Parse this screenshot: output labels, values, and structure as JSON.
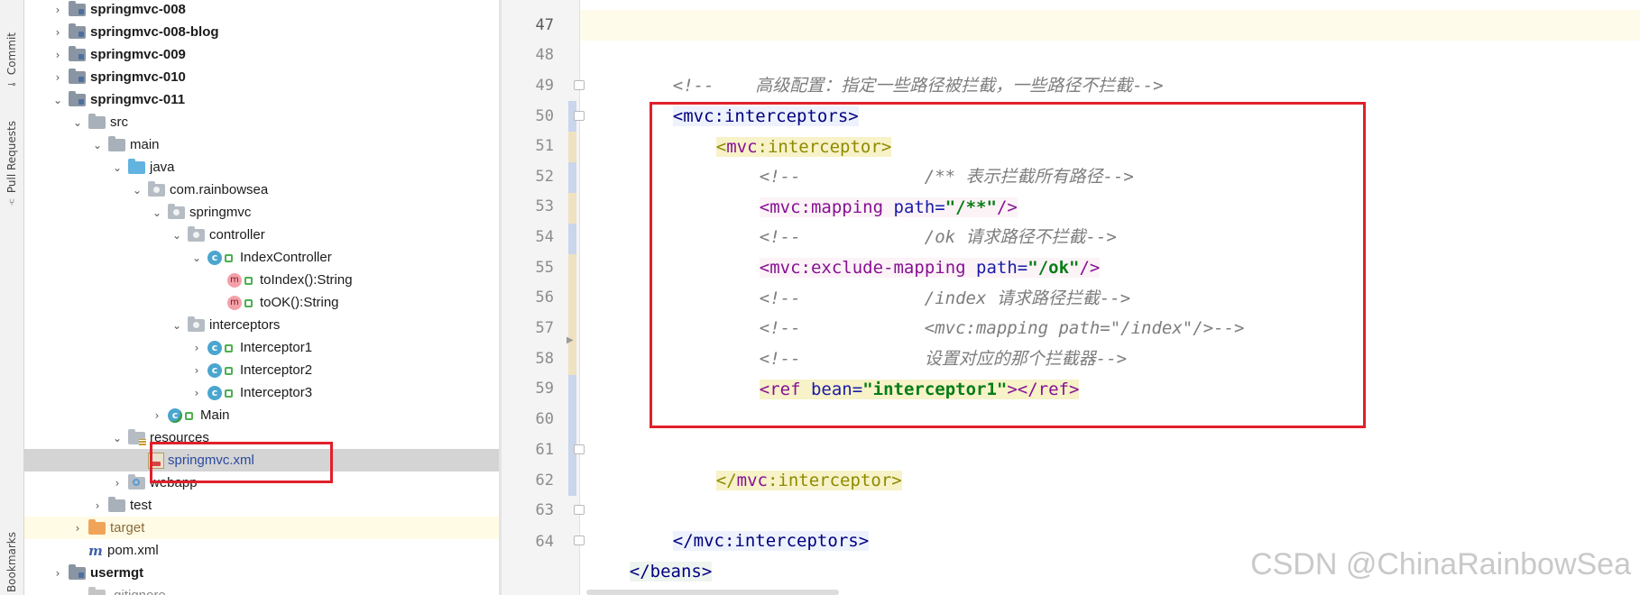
{
  "toolstrip": {
    "commit": "Commit",
    "pull_requests": "Pull Requests",
    "bookmarks": "Bookmarks"
  },
  "tree": {
    "rows": [
      {
        "label": "springmvc-008",
        "kind": "module",
        "arrow": "right"
      },
      {
        "label": "springmvc-008-blog",
        "kind": "module",
        "arrow": "right"
      },
      {
        "label": "springmvc-009",
        "kind": "module",
        "arrow": "right"
      },
      {
        "label": "springmvc-010",
        "kind": "module",
        "arrow": "right"
      },
      {
        "label": "springmvc-011",
        "kind": "module",
        "arrow": "down"
      },
      {
        "label": "src",
        "kind": "folder",
        "arrow": "down"
      },
      {
        "label": "main",
        "kind": "folder",
        "arrow": "down"
      },
      {
        "label": "java",
        "kind": "source-folder",
        "arrow": "down"
      },
      {
        "label": "com.rainbowsea",
        "kind": "package",
        "arrow": "down"
      },
      {
        "label": "springmvc",
        "kind": "package",
        "arrow": "down"
      },
      {
        "label": "controller",
        "kind": "package",
        "arrow": "down"
      },
      {
        "label": "IndexController",
        "kind": "class",
        "arrow": "down"
      },
      {
        "label": "toIndex():String",
        "kind": "method",
        "arrow": "none"
      },
      {
        "label": "toOK():String",
        "kind": "method",
        "arrow": "none"
      },
      {
        "label": "interceptors",
        "kind": "package",
        "arrow": "down"
      },
      {
        "label": "Interceptor1",
        "kind": "class",
        "arrow": "right"
      },
      {
        "label": "Interceptor2",
        "kind": "class",
        "arrow": "right"
      },
      {
        "label": "Interceptor3",
        "kind": "class",
        "arrow": "right"
      },
      {
        "label": "Main",
        "kind": "main-class",
        "arrow": "right"
      },
      {
        "label": "resources",
        "kind": "resources",
        "arrow": "down"
      },
      {
        "label": "springmvc.xml",
        "kind": "xml",
        "arrow": "none"
      },
      {
        "label": "webapp",
        "kind": "webapp",
        "arrow": "right"
      },
      {
        "label": "test",
        "kind": "folder",
        "arrow": "right"
      },
      {
        "label": "target",
        "kind": "target",
        "arrow": "right"
      },
      {
        "label": "pom.xml",
        "kind": "maven",
        "arrow": "none"
      },
      {
        "label": "usermgt",
        "kind": "module",
        "arrow": "right"
      },
      {
        "label": ".gitignore",
        "kind": "file",
        "arrow": "none"
      }
    ]
  },
  "editor": {
    "line_numbers": [
      "47",
      "48",
      "49",
      "50",
      "51",
      "52",
      "53",
      "54",
      "55",
      "56",
      "57",
      "58",
      "59",
      "60",
      "61",
      "62",
      "63",
      "64"
    ],
    "lines": {
      "l48_comment": "<!--    高级配置：指定一些路径被拦截，一些路径不拦截-->",
      "l49_open": "<",
      "l49_ns": "mvc",
      "l49_name": ":interceptors",
      "l49_close": ">",
      "l50_open": "<",
      "l50_ns": "mvc",
      "l50_name": ":interceptor",
      "l50_close": ">",
      "l51_comment": "<!--            /** 表示拦截所有路径-->",
      "l52_open": "<",
      "l52_ns": "mvc",
      "l52_name": ":mapping",
      "l52_attr": "path",
      "l52_eq": "=",
      "l52_val": "\"/**\"",
      "l52_close": "/>",
      "l53_comment": "<!--            /ok 请求路径不拦截-->",
      "l54_open": "<",
      "l54_ns": "mvc",
      "l54_name": ":exclude-mapping",
      "l54_attr": "path",
      "l54_eq": "=",
      "l54_val": "\"/ok\"",
      "l54_close": "/>",
      "l55_comment": "<!--            /index 请求路径拦截-->",
      "l56_comment": "<!--            <mvc:mapping path=\"/index\"/>-->",
      "l57_comment": "<!--            设置对应的那个拦截器-->",
      "l58_open": "<ref",
      "l58_attr": "bean",
      "l58_eq": "=",
      "l58_val": "\"interceptor1\"",
      "l58_close": "></ref>",
      "l61_open": "</",
      "l61_ns": "mvc",
      "l61_name": ":interceptor",
      "l61_close": ">",
      "l63_open": "</",
      "l63_ns": "mvc",
      "l63_name": ":interceptors",
      "l63_close": ">",
      "l64_text": "</beans>"
    }
  },
  "watermark": "CSDN @ChinaRainbowSea",
  "colors": {
    "highlight_box": "#e0202b",
    "comment": "#7d7d7d",
    "tag": "#000080",
    "namespace": "#871094",
    "attribute": "#1a1aa6",
    "value": "#067d17"
  }
}
